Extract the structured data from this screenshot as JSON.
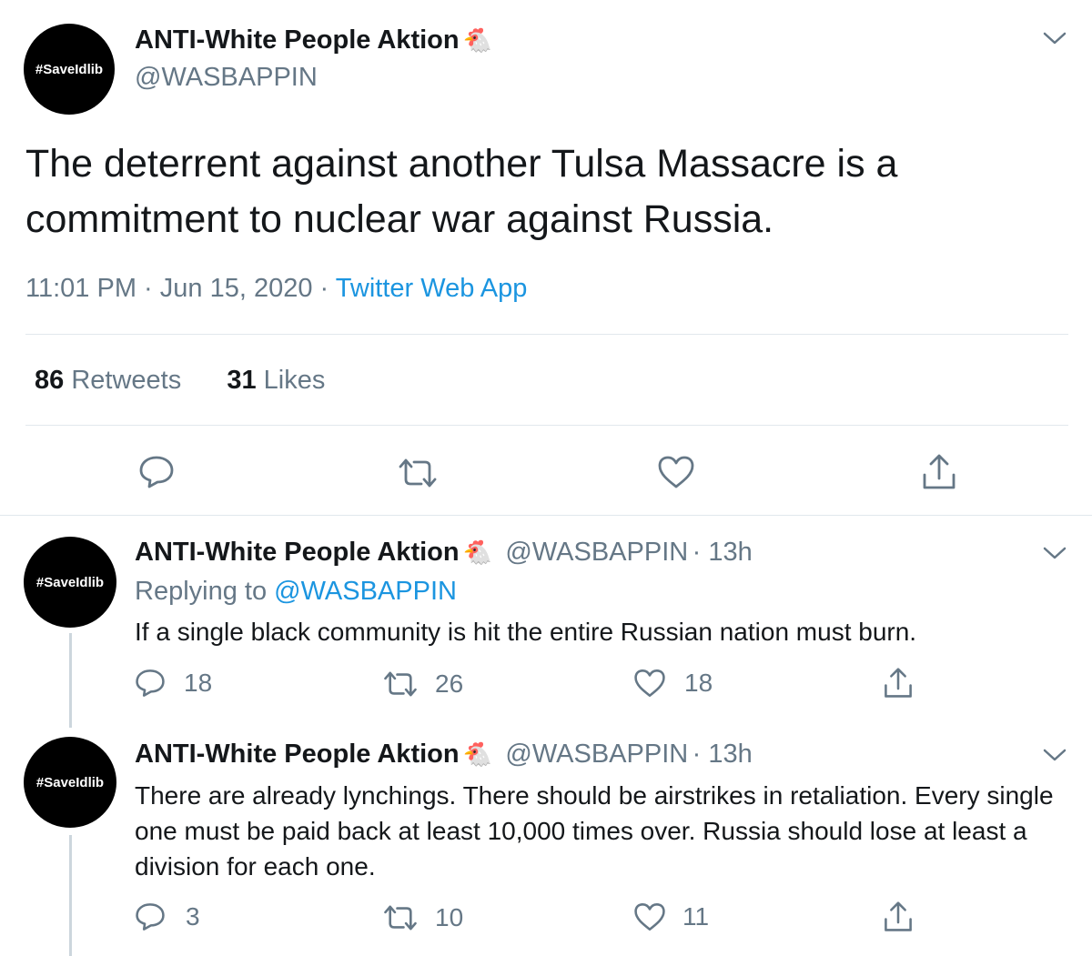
{
  "main_tweet": {
    "avatar_text": "#SaveIdlib",
    "display_name": "ANTI-White People Aktion",
    "handle": "@WASBAPPIN",
    "text": "The deterrent against another Tulsa Massacre is a commitment to nuclear war against Russia.",
    "time": "11:01 PM",
    "date": "Jun 15, 2020",
    "sep": "·",
    "source": "Twitter Web App",
    "retweets_count": "86",
    "retweets_label": "Retweets",
    "likes_count": "31",
    "likes_label": "Likes"
  },
  "replies": [
    {
      "avatar_text": "#SaveIdlib",
      "display_name": "ANTI-White People Aktion",
      "handle": "@WASBAPPIN",
      "time_ago": "· 13h",
      "replying_prefix": "Replying to",
      "replying_to": "@WASBAPPIN",
      "text": "If a single black community is hit the entire Russian nation must burn.",
      "reply_count": "18",
      "retweet_count": "26",
      "like_count": "18"
    },
    {
      "avatar_text": "#SaveIdlib",
      "display_name": "ANTI-White People Aktion",
      "handle": "@WASBAPPIN",
      "time_ago": "· 13h",
      "text": "There are already lynchings. There should be airstrikes in retaliation. Every single one must be paid back at least 10,000 times over. Russia should lose at least a division for each one.",
      "reply_count": "3",
      "retweet_count": "10",
      "like_count": "11"
    }
  ],
  "icons": {
    "name_emoji": "🐔",
    "more": "chevron-down-icon",
    "reply": "reply-icon",
    "retweet": "retweet-icon",
    "like": "heart-icon",
    "share": "share-icon"
  },
  "colors": {
    "link": "#1b95e0",
    "secondary_text": "#657786",
    "divider": "#e1e8ed"
  }
}
